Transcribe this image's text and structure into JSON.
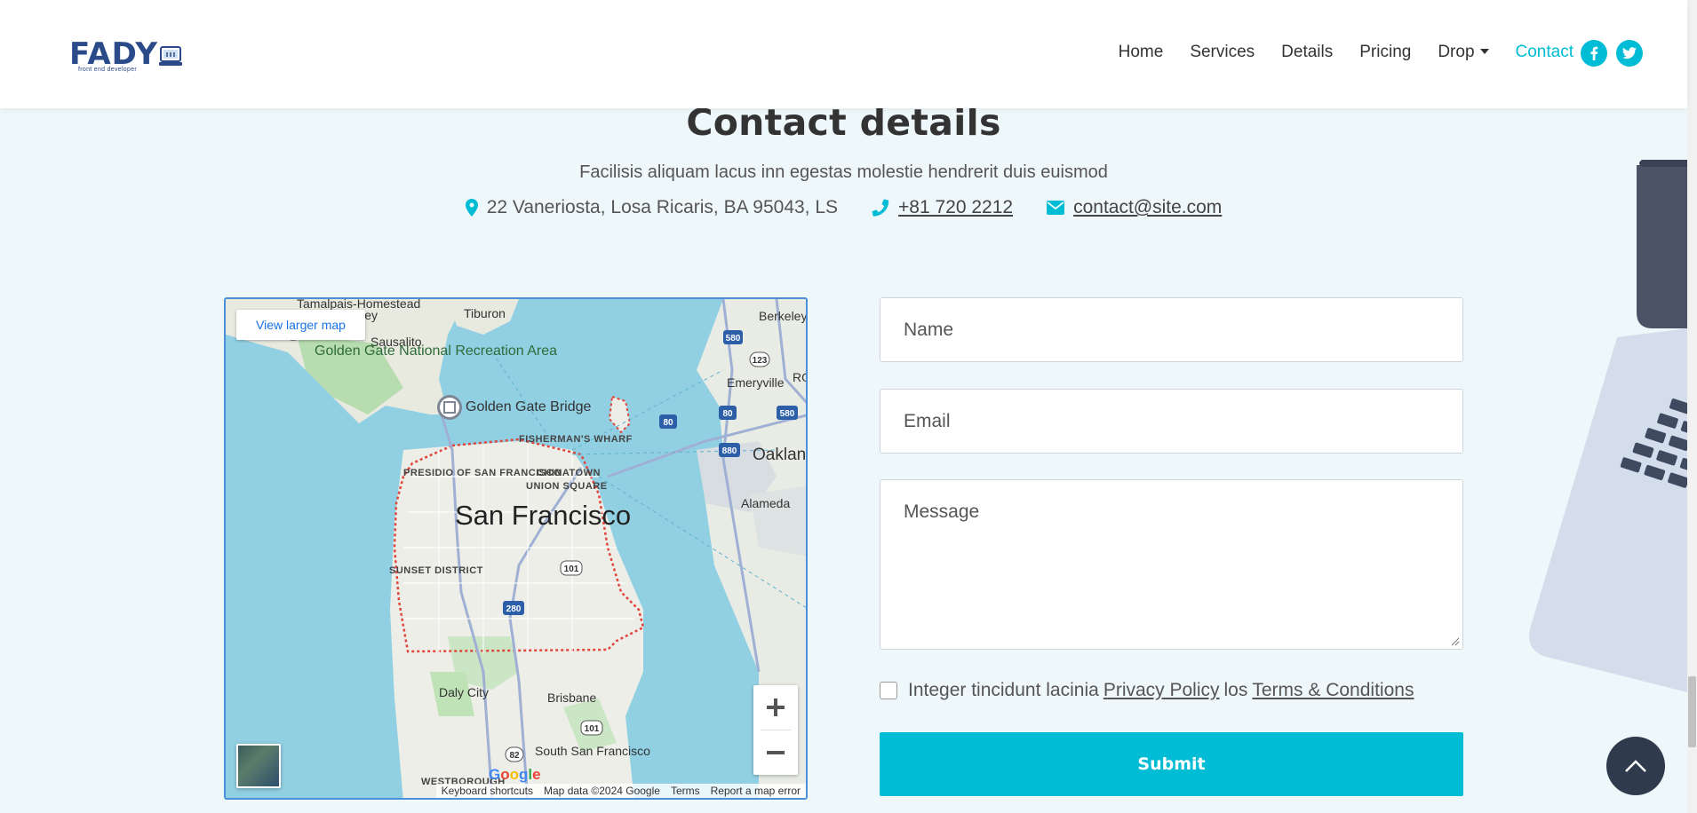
{
  "nav": {
    "logo_text": "FADY",
    "logo_tagline": "front end developer",
    "items": [
      {
        "label": "Home"
      },
      {
        "label": "Services"
      },
      {
        "label": "Details"
      },
      {
        "label": "Pricing"
      },
      {
        "label": "Drop"
      },
      {
        "label": "Contact"
      }
    ],
    "active": "Contact",
    "social": [
      "facebook-icon",
      "twitter-icon"
    ],
    "accent_color": "#00bcd4"
  },
  "header": {
    "title": "Contact details",
    "subtitle": "Facilisis aliquam lacus inn egestas molestie hendrerit duis euismod",
    "address": "22 Vaneriosta, Losa Ricaris, BA 95043, LS",
    "phone": "+81 720 2212",
    "email": "contact@site.com"
  },
  "map": {
    "view_larger": "View larger map",
    "labels": {
      "tamalpais": "Tamalpais-Homestead",
      "valley": "lley",
      "tiburon": "Tiburon",
      "berkeley": "Berkeley",
      "sausalito": "Sausalito",
      "ggnra": "Golden Gate National Recreation Area",
      "emeryville": "Emeryville",
      "ro": "RO",
      "ggbridge": "Golden Gate Bridge",
      "fishermans": "FISHERMAN'S WHARF",
      "oakland": "Oaklan",
      "presidio": "PRESIDIO OF SAN FRANCISCO",
      "chinatown": "CHINATOWN",
      "union": "UNION SQUARE",
      "alameda": "Alameda",
      "sf": "San Francisco",
      "sunset": "SUNSET DISTRICT",
      "daly": "Daly City",
      "brisbane": "Brisbane",
      "ssf": "South San Francisco",
      "westborough": "WESTBOROUGH"
    },
    "footer": {
      "shortcuts": "Keyboard shortcuts",
      "data": "Map data ©2024 Google",
      "terms": "Terms",
      "report": "Report a map error"
    },
    "google": "Google"
  },
  "form": {
    "name_placeholder": "Name",
    "email_placeholder": "Email",
    "message_placeholder": "Message",
    "terms_text": "Integer tincidunt lacinia",
    "privacy_link": "Privacy Policy",
    "terms_join": "los",
    "terms_link": "Terms & Conditions",
    "submit_label": "Submit"
  }
}
